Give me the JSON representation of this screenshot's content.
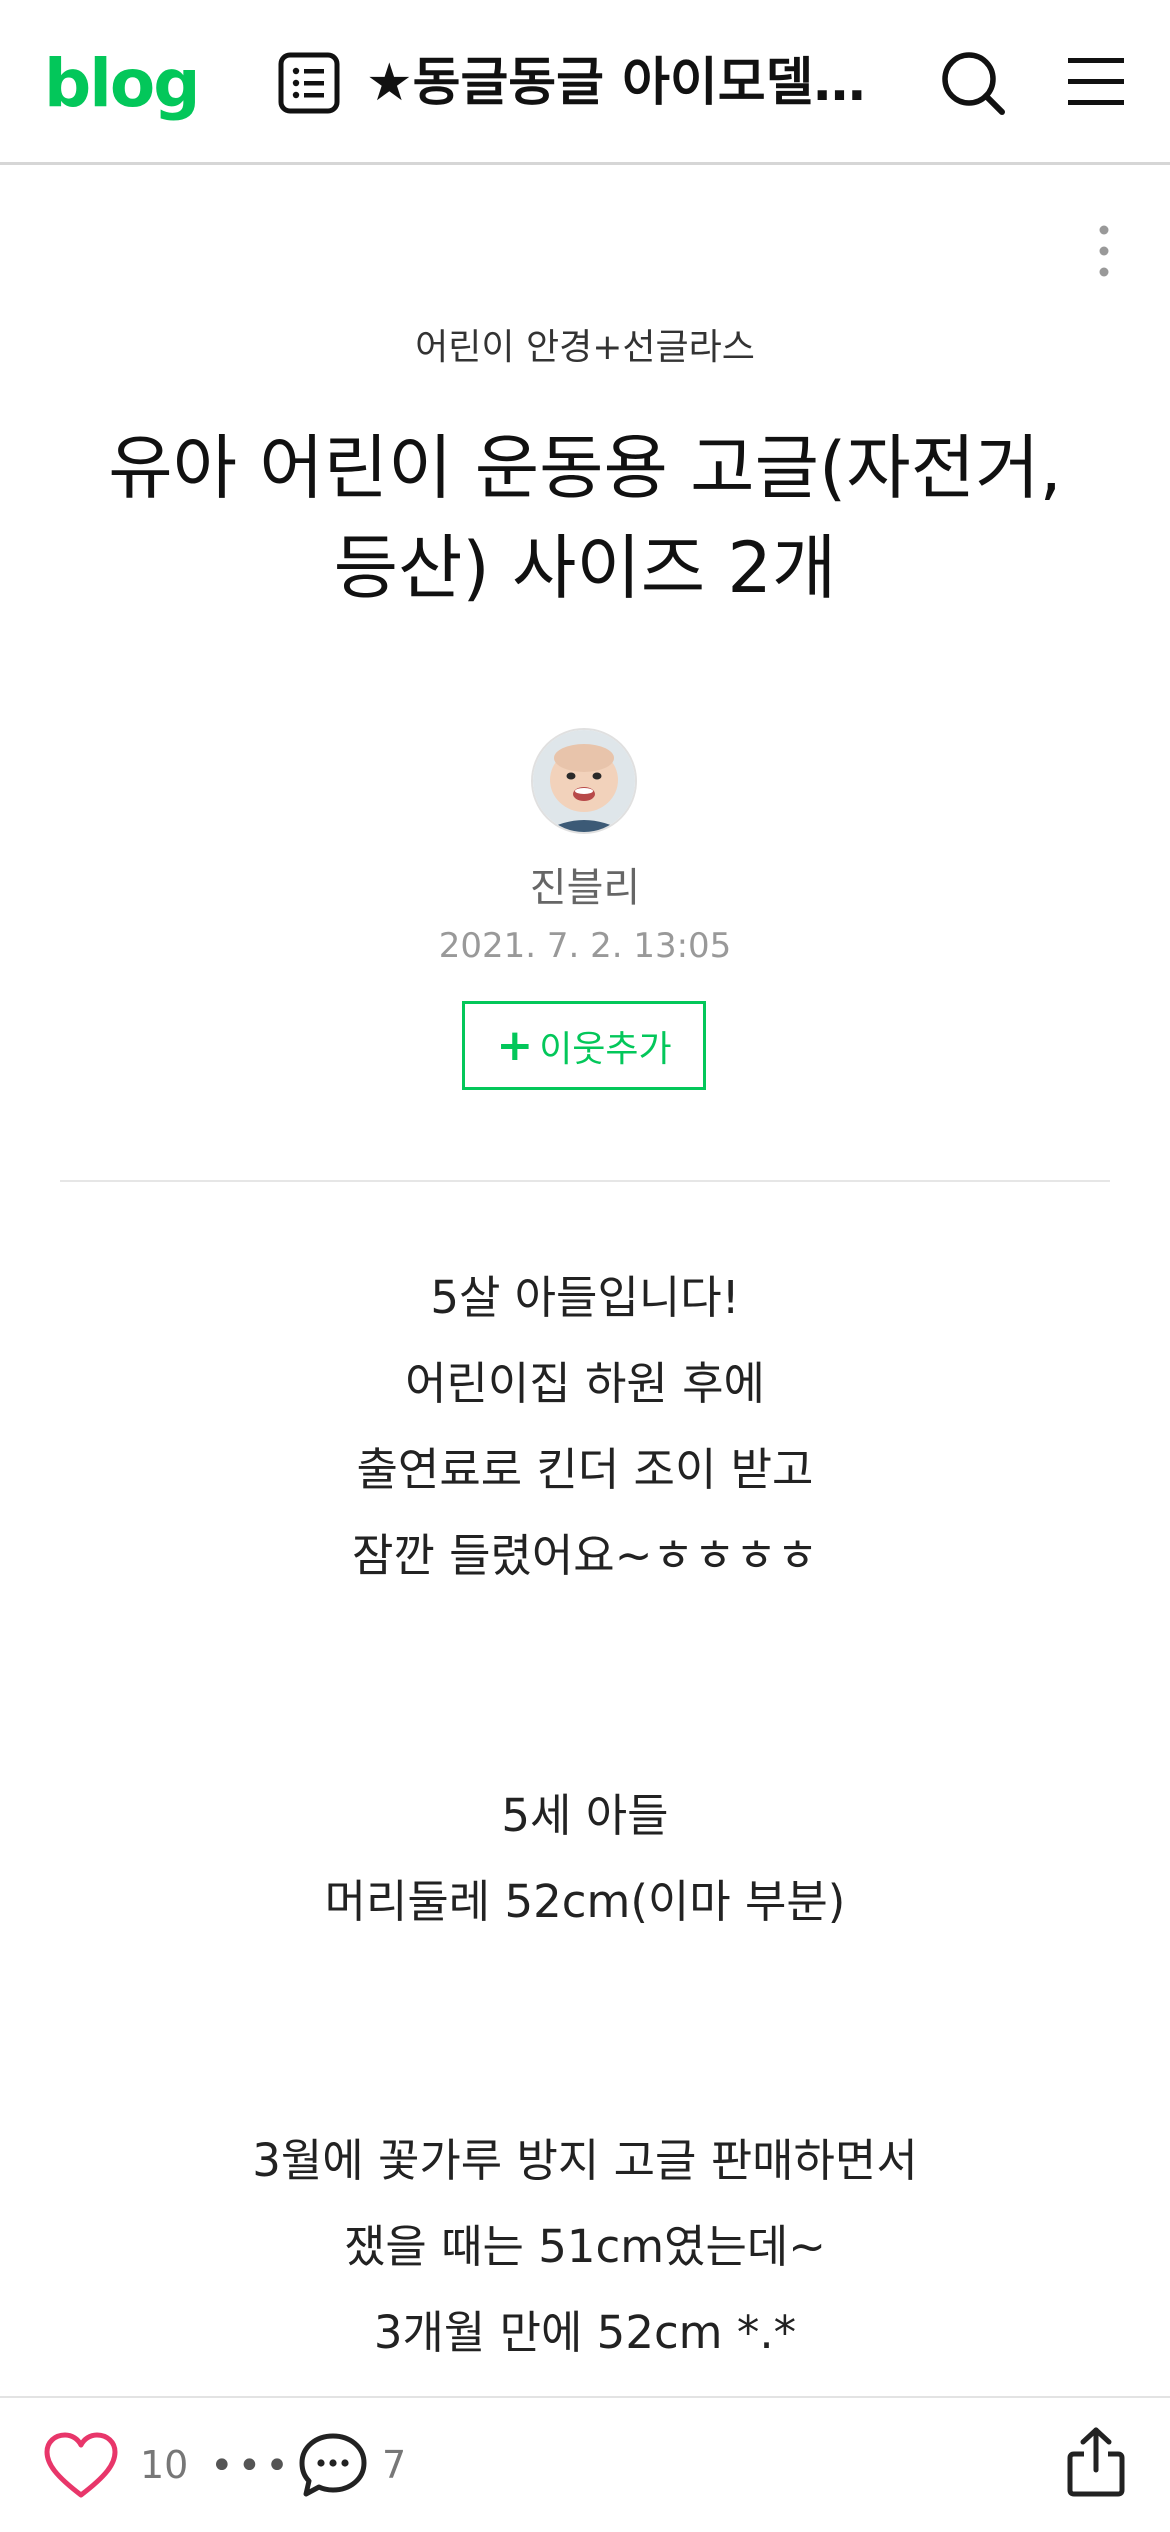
{
  "header": {
    "logo": "blog",
    "title": "★동글동글 아이모델 ..."
  },
  "post": {
    "category": "어린이 안경+선글라스",
    "title": "유아 어린이 운동용 고글(자전거, 등산) 사이즈 2개",
    "author": "진블리",
    "date": "2021. 7. 2. 13:05",
    "follow_label": "이웃추가",
    "paragraphs": [
      [
        "5살 아들입니다!",
        "어린이집 하원 후에",
        "출연료로 킨더 조이 받고",
        "잠깐 들렸어요~ㅎㅎㅎㅎ"
      ],
      [
        "5세 아들",
        "머리둘레 52cm(이마 부분)"
      ],
      [
        "3월에 꽃가루 방지 고글 판매하면서",
        "쟀을 때는 51cm였는데~",
        "3개월 만에 52cm *.*"
      ]
    ]
  },
  "bottom_bar": {
    "like_count": "10",
    "more_dots": "•••",
    "comment_count": "7"
  },
  "colors": {
    "brand": "#03c75a",
    "like": "#e8366a"
  },
  "icons": [
    "post-list-icon",
    "search-icon",
    "menu-icon",
    "more-vertical-icon",
    "heart-icon",
    "comment-icon",
    "share-icon"
  ]
}
